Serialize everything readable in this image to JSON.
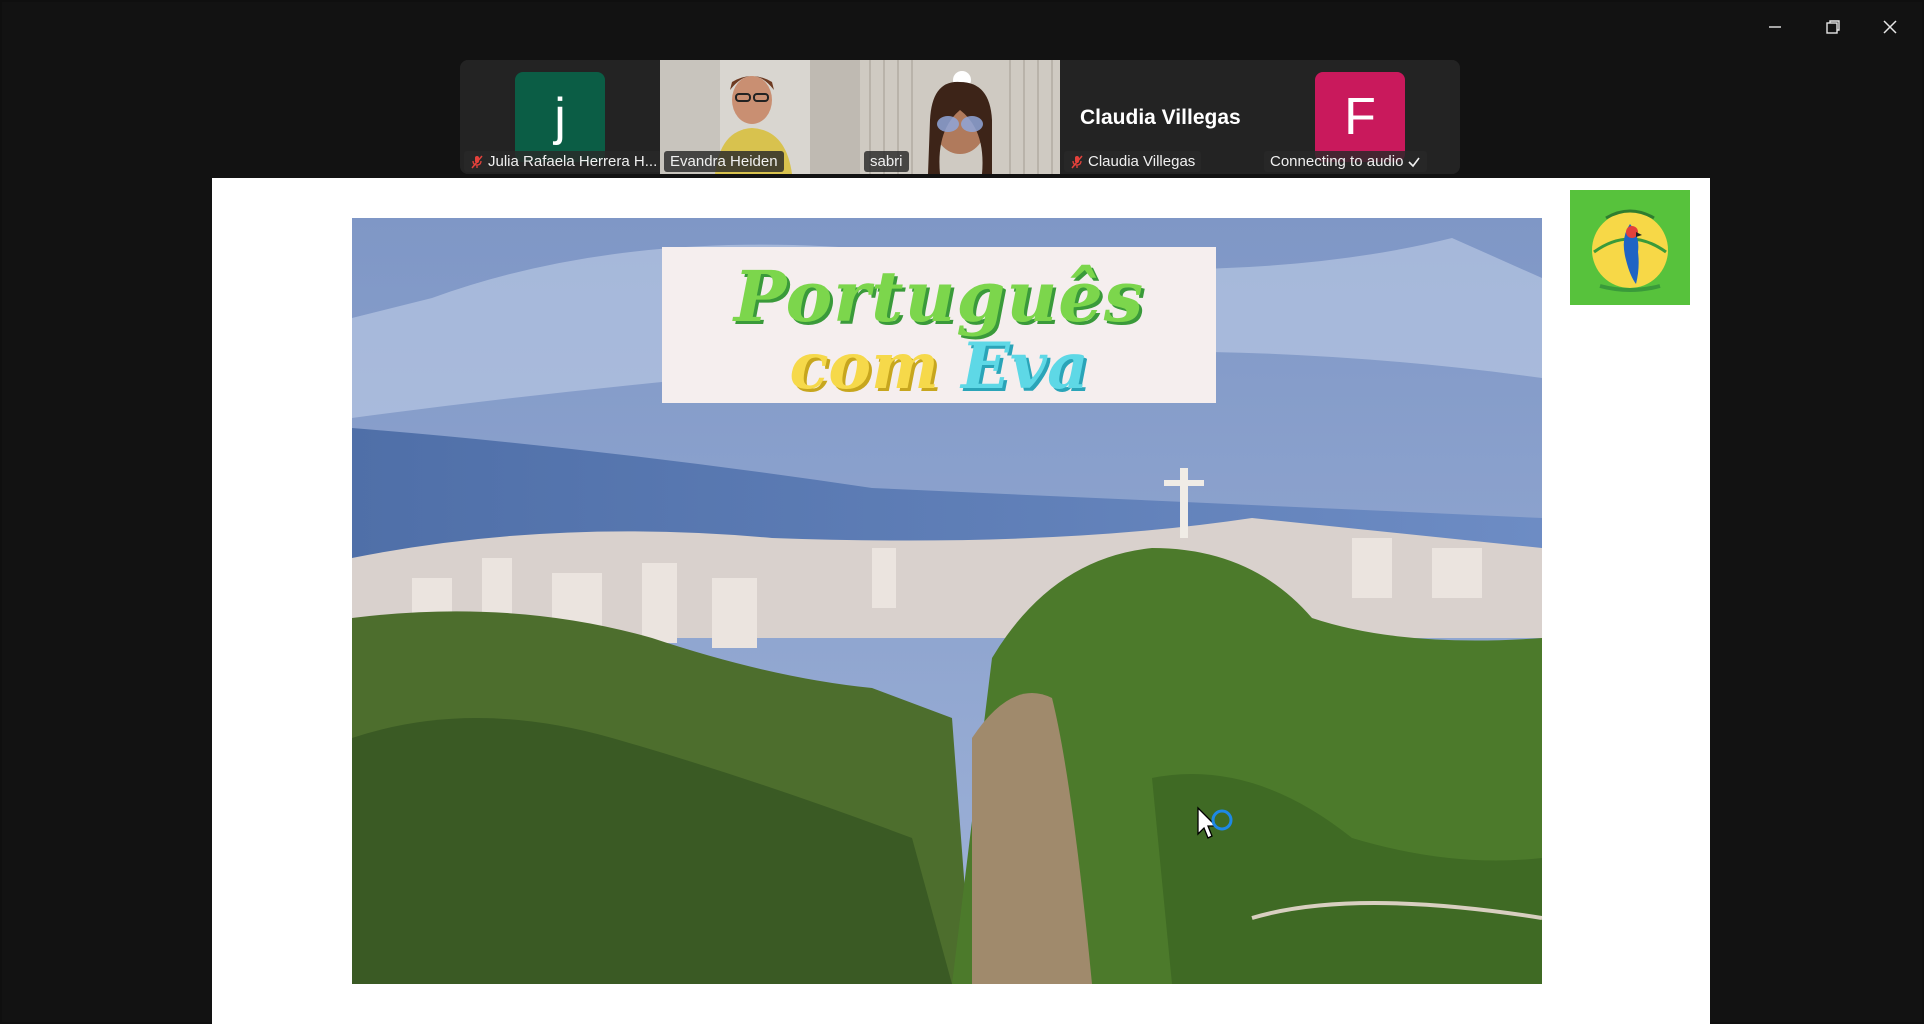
{
  "window": {
    "controls": [
      "minimize",
      "restore",
      "close"
    ]
  },
  "participants": [
    {
      "name": "Julia Rafaela Herrera H...",
      "initial": "j",
      "avatar_color": "#0b5d45",
      "muted": true,
      "type": "avatar"
    },
    {
      "name": "Evandra Heiden",
      "muted": false,
      "type": "video"
    },
    {
      "name": "sabri",
      "muted": false,
      "type": "video",
      "active_speaker": true
    },
    {
      "name": "Claudia Villegas",
      "display_title": "Claudia Villegas",
      "muted": true,
      "type": "name"
    },
    {
      "name": "Connecting to audio",
      "initial": "F",
      "avatar_color": "#c9195c",
      "muted": false,
      "type": "avatar",
      "connecting": true
    }
  ],
  "share": {
    "title_line1": "Português",
    "title_word_com": "com",
    "title_word_eva": "Eva",
    "logo_caption": "Português com Eva"
  },
  "colors": {
    "active_speaker_border": "#23d18b",
    "logo_bg": "#57c23c"
  }
}
